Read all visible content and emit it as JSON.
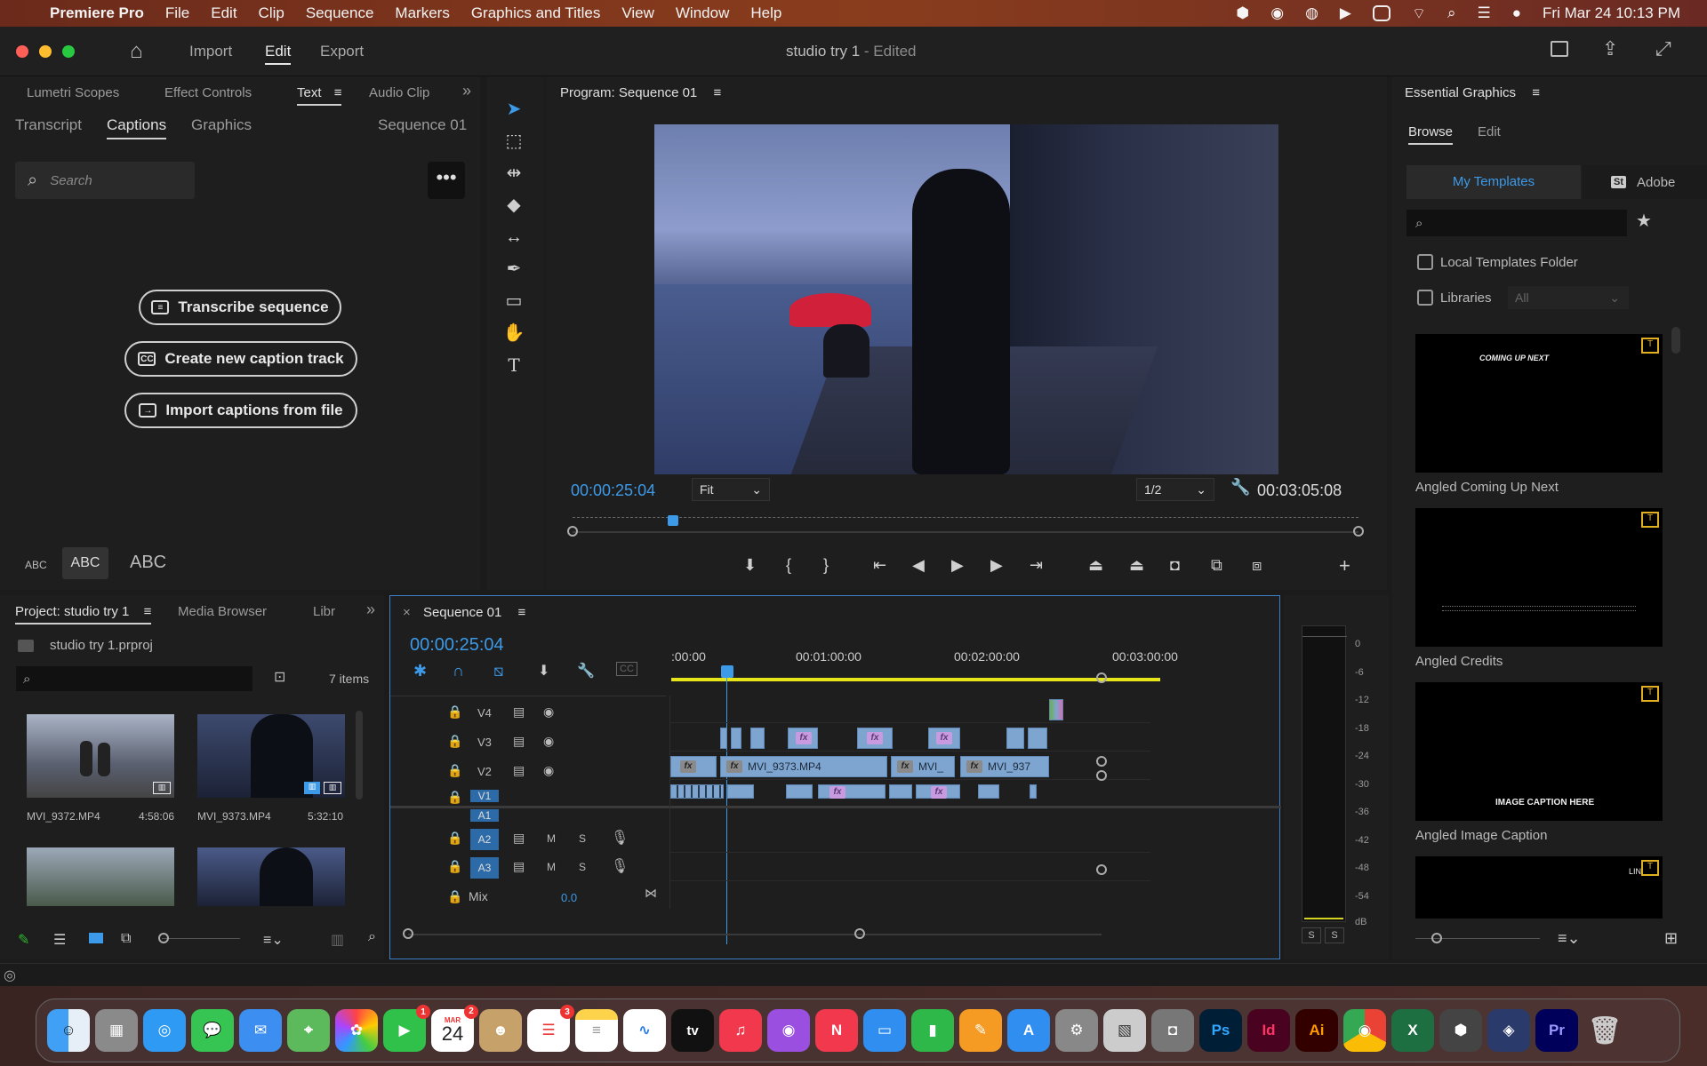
{
  "menubar": {
    "app": "Premiere Pro",
    "items": [
      "File",
      "Edit",
      "Clip",
      "Sequence",
      "Markers",
      "Graphics and Titles",
      "View",
      "Window",
      "Help"
    ],
    "datetime": "Fri Mar 24  10:13 PM"
  },
  "titlebar": {
    "nav": [
      "Import",
      "Edit",
      "Export"
    ],
    "project": "studio try 1",
    "status": "- Edited"
  },
  "text_panel": {
    "top_tabs": [
      "Lumetri Scopes",
      "Effect Controls",
      "Text",
      "Audio Clip"
    ],
    "sub_tabs": [
      "Transcript",
      "Captions",
      "Graphics"
    ],
    "sequence": "Sequence 01",
    "search_placeholder": "Search",
    "buttons": {
      "transcribe": "Transcribe sequence",
      "new_caption": "Create new caption track",
      "import_captions": "Import captions from file"
    },
    "cc_badge": "CC",
    "size_labels": [
      "ABC",
      "ABC",
      "ABC"
    ]
  },
  "program": {
    "title": "Program: Sequence 01",
    "timecode": "00:00:25:04",
    "fit": "Fit",
    "resolution": "1/2",
    "duration": "00:03:05:08",
    "playhead_fraction": 0.128
  },
  "essential": {
    "title": "Essential Graphics",
    "tabs": [
      "Browse",
      "Edit"
    ],
    "source_tabs": [
      "My Templates",
      "Adobe"
    ],
    "stock_badge": "St",
    "local_folder": "Local Templates Folder",
    "libraries": "Libraries",
    "libraries_select": "All",
    "templates": [
      {
        "name": "Angled Coming Up Next",
        "preview_text": "COMING UP NEXT"
      },
      {
        "name": "Angled Credits",
        "preview_text": ""
      },
      {
        "name": "Angled Image Caption",
        "preview_text": "IMAGE CAPTION HERE"
      },
      {
        "name": "",
        "preview_text": "LIN"
      }
    ]
  },
  "project": {
    "tabs": [
      "Project: studio try 1",
      "Media Browser",
      "Libr"
    ],
    "file": "studio try 1.prproj",
    "items_count": "7 items",
    "clips": [
      {
        "name": "MVI_9372.MP4",
        "duration": "4:58:06"
      },
      {
        "name": "MVI_9373.MP4",
        "duration": "5:32:10"
      }
    ]
  },
  "timeline": {
    "title": "Sequence 01",
    "timecode": "00:00:25:04",
    "ruler": [
      ":00:00",
      "00:01:00:00",
      "00:02:00:00",
      "00:03:00:00"
    ],
    "video_tracks": [
      "V4",
      "V3",
      "V2",
      "V1"
    ],
    "audio_tracks": [
      "A1",
      "A2",
      "A3"
    ],
    "mix_label": "Mix",
    "mix_value": "0.0",
    "clip_labels": [
      "MVI_9373.MP4",
      "MVI_",
      "MVI_937"
    ],
    "m_label": "M",
    "s_label": "S",
    "fx_label": "fx",
    "cc_label": "CC"
  },
  "meter": {
    "scale": [
      "0",
      "-6",
      "-12",
      "-18",
      "-24",
      "-30",
      "-36",
      "-42",
      "-48",
      "-54",
      "dB"
    ],
    "solo": [
      "S",
      "S"
    ]
  },
  "dock": {
    "facetime_badge": "1",
    "calendar_month": "MAR",
    "calendar_day": "24",
    "calendar_badge": "2",
    "reminders_badge": "3",
    "appletv": "tv",
    "ps": "Ps",
    "id": "Id",
    "ai": "Ai",
    "pr": "Pr"
  }
}
